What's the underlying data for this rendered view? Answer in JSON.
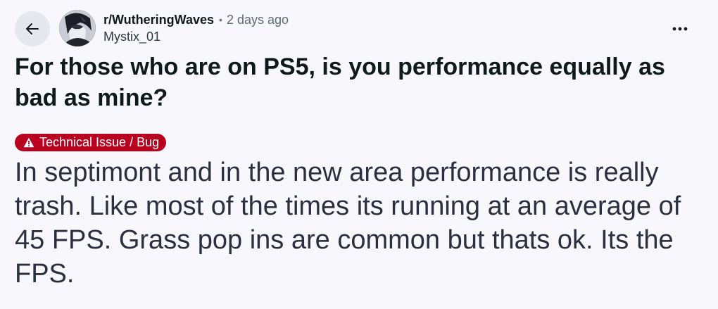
{
  "post": {
    "subreddit": "r/WutheringWaves",
    "separator": "•",
    "time_ago": "2 days ago",
    "author": "Mystix_01",
    "title": "For those who are on PS5, is you performance equally as bad as mine?",
    "flair": {
      "label": "Technical Issue / Bug",
      "icon": "warning-icon",
      "color": "#b8001f"
    },
    "body": "In septimont and in the new area performance is really trash. Like most of the times its running at an average of 45 FPS. Grass pop ins are common but thats ok. Its the FPS."
  },
  "icons": {
    "back": "arrow-left-icon",
    "more": "more-options-icon"
  }
}
